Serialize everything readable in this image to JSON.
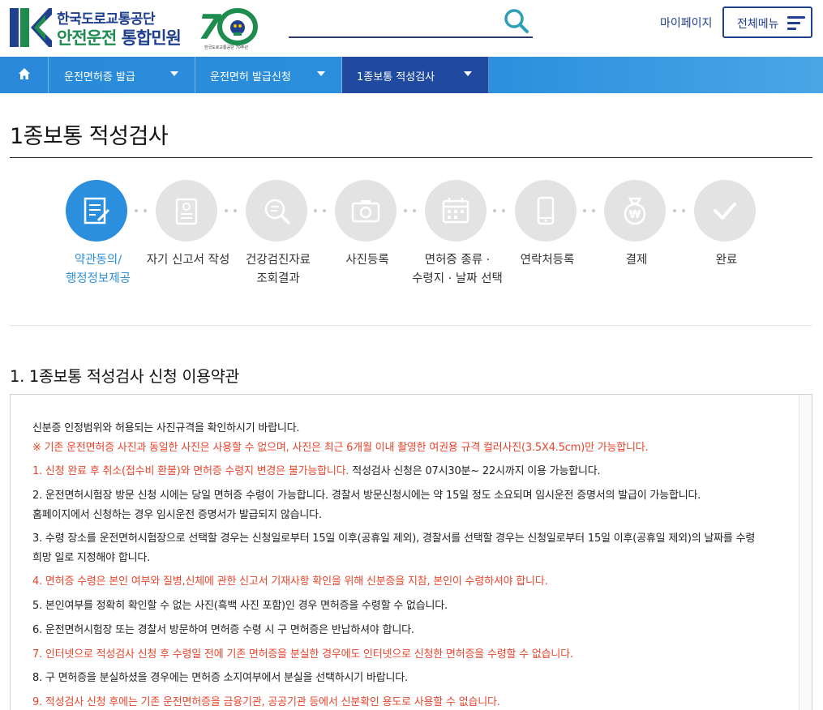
{
  "header": {
    "logo_line1": "한국도로교통공단",
    "logo_line2_green": "안전운전",
    "logo_line2_blue": "통합민원",
    "anniversary_badge": "70",
    "anniversary_caption": "한국도로교통공단 70주년",
    "search_placeholder": "",
    "mypage_label": "마이페이지",
    "menu_label": "전체메뉴"
  },
  "nav": {
    "home_icon": "home-icon",
    "items": [
      {
        "label": "운전면허증 발급"
      },
      {
        "label": "운전면허 발급신청"
      },
      {
        "label": "1종보통 적성검사"
      }
    ]
  },
  "page": {
    "title": "1종보통 적성검사"
  },
  "steps": [
    {
      "line1": "약관동의/",
      "line2": "행정정보제공",
      "icon": "document-edit-icon",
      "active": true
    },
    {
      "line1": "자기 신고서 작성",
      "line2": "",
      "icon": "clipboard-icon",
      "active": false
    },
    {
      "line1": "건강검진자료",
      "line2": "조회결과",
      "icon": "magnifier-document-icon",
      "active": false
    },
    {
      "line1": "사진등록",
      "line2": "",
      "icon": "camera-icon",
      "active": false
    },
    {
      "line1": "면허증 종류 ·",
      "line2": "수령지 · 날짜 선택",
      "icon": "calendar-icon",
      "active": false
    },
    {
      "line1": "연락처등록",
      "line2": "",
      "icon": "phone-icon",
      "active": false
    },
    {
      "line1": "결제",
      "line2": "",
      "icon": "won-bag-icon",
      "active": false
    },
    {
      "line1": "완료",
      "line2": "",
      "icon": "check-icon",
      "active": false
    }
  ],
  "terms": {
    "title": "1. 1종보통 적성검사 신청 이용약관",
    "lines": [
      {
        "text": "신분증 인정범위와 허용되는 사진규격을 확인하시기 바랍니다.",
        "red": false
      },
      {
        "text": "※ 기존 운전면허증 사진과 동일한 사진은 사용할 수 없으며, 사진은 최근 6개월 이내 촬영한 여권용 규격 컬러사진(3.5X4.5cm)만 가능합니다.",
        "red": true
      },
      {
        "red_part": "1. 신청 완료 후 취소(접수비 환불)와 면허증 수령지 변경은 불가능합니다.",
        "text": " 적성검사 신청은 07시30분~ 22시까지 이용 가능합니다.",
        "red": false
      },
      {
        "text": "2. 운전면허시험장 방문 신청 시에는 당일 면허증 수령이 가능합니다. 경찰서 방문신청시에는 약 15일 정도 소요되며 임시운전 증명서의 발급이 가능합니다.",
        "red": false
      },
      {
        "text": "홈페이지에서 신청하는 경우 임시운전 증명서가 발급되지 않습니다.",
        "red": false
      },
      {
        "text": "3. 수령 장소를 운전면허시험장으로 선택할 경우는 신청일로부터 15일 이후(공휴일 제외), 경찰서를 선택할 경우는 신청일로부터 15일 이후(공휴일 제외)의 날짜를 수령",
        "red": false
      },
      {
        "text": "희망 일로 지정해야 합니다.",
        "red": false
      },
      {
        "text": "4. 면허증 수령은 본인 여부와 질병,신체에 관한 신고서 기재사항 확인을 위해 신분증을 지참, 본인이 수령하셔야 합니다.",
        "red": true
      },
      {
        "text": "5. 본인여부를 정확히 확인할 수 없는 사진(흑백 사진 포함)인 경우 면허증을 수령할 수 없습니다.",
        "red": false
      },
      {
        "text": "6. 운전면허시험장 또는 경찰서 방문하여 면허증 수령 시 구 면허증은 반납하셔야 합니다.",
        "red": false
      },
      {
        "text": "7. 인터넷으로 적성검사 신청 후 수령일 전에 기존 면허증을 분실한 경우에도 인터넷으로 신청한 면허증을 수령할 수 없습니다.",
        "red": true
      },
      {
        "text": "8. 구 면허증을 분실하셨을 경우에는 면허증 소지여부에서 분실을 선택하시기 바랍니다.",
        "red": false
      },
      {
        "text": "9. 적성검사 신청 후에는 기존 운전면허증을 금융기관, 공공기관 등에서 신분확인 용도로 사용할 수 없습니다.",
        "red": true
      }
    ]
  },
  "colors": {
    "brand_blue": "#1f3f8f",
    "brand_green": "#1e8c4e",
    "nav_blue": "#2b8fdd",
    "nav_active": "#1f4aa0",
    "active_step": "#2b8fdd",
    "inactive_step": "#e3e3e3",
    "warning_red": "#e8452c"
  }
}
